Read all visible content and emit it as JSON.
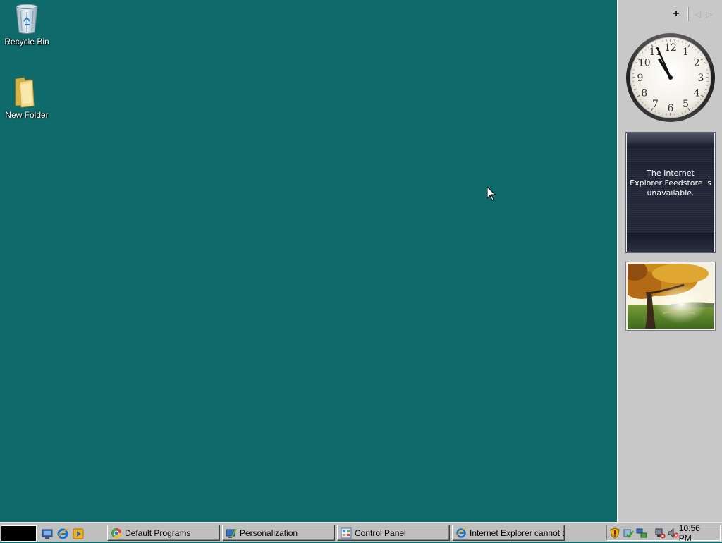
{
  "desktop": {
    "icons": [
      {
        "label": "Recycle Bin",
        "icon": "recycle-bin-icon"
      },
      {
        "label": "New Folder",
        "icon": "folder-icon"
      }
    ],
    "background_color": "#0e6a6b"
  },
  "sidebar": {
    "toolbar": {
      "add_label": "+",
      "prev_label": "◁",
      "next_label": "▷"
    },
    "clock": {
      "hour": 10,
      "minute": 56,
      "numerals": [
        "12",
        "1",
        "2",
        "3",
        "4",
        "5",
        "6",
        "7",
        "8",
        "9",
        "10",
        "11"
      ]
    },
    "feed_headlines": {
      "message": "The Internet Explorer Feedstore is unavailable."
    },
    "slideshow": {
      "image": "autumn-tree-landscape"
    }
  },
  "taskbar": {
    "quick_launch": [
      "show-desktop-icon",
      "internet-explorer-icon",
      "media-player-icon"
    ],
    "tasks": [
      {
        "label": "Default Programs",
        "icon": "default-programs-icon"
      },
      {
        "label": "Personalization",
        "icon": "personalization-icon"
      },
      {
        "label": "Control Panel",
        "icon": "control-panel-icon"
      },
      {
        "label": "Internet Explorer cannot d...",
        "icon": "internet-explorer-icon"
      }
    ],
    "tray": {
      "icons": [
        "security-shield-icon",
        "network-icon",
        "speaker-muted-icon"
      ],
      "time": "10:56 PM"
    }
  }
}
